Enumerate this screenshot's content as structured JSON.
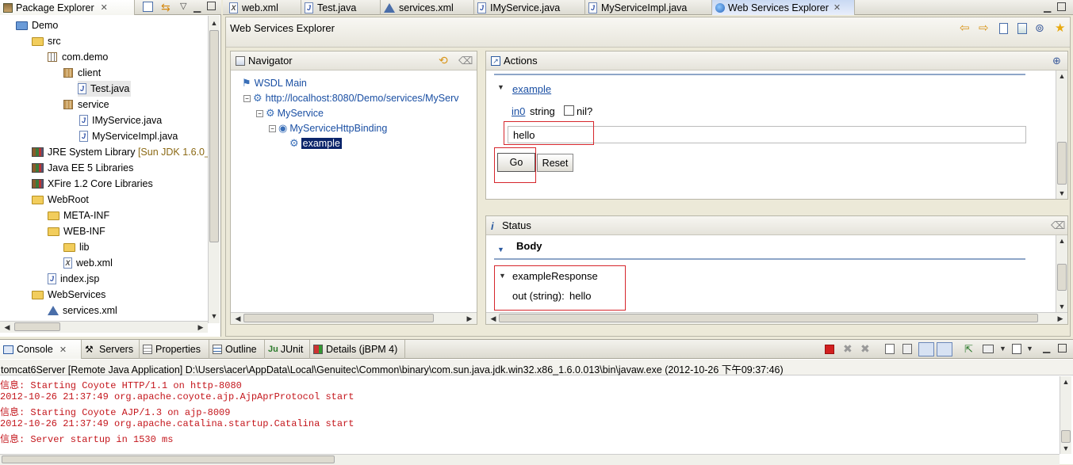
{
  "package_explorer": {
    "tab_label": "Package Explorer",
    "tree": [
      {
        "label": "Demo",
        "icon": "project-icon"
      },
      {
        "label": "src",
        "icon": "source-folder-icon"
      },
      {
        "label": "com.demo",
        "icon": "package-icon"
      },
      {
        "label": "client",
        "icon": "package-icon"
      },
      {
        "label": "Test.java",
        "icon": "java-file-icon"
      },
      {
        "label": "service",
        "icon": "package-icon"
      },
      {
        "label": "IMyService.java",
        "icon": "java-file-icon"
      },
      {
        "label": "MyServiceImpl.java",
        "icon": "java-file-icon"
      },
      {
        "label": "JRE System Library",
        "suffix": "[Sun JDK 1.6.0_",
        "icon": "library-icon"
      },
      {
        "label": "Java EE 5 Libraries",
        "icon": "library-icon"
      },
      {
        "label": "XFire 1.2 Core Libraries",
        "icon": "library-icon"
      },
      {
        "label": "WebRoot",
        "icon": "folder-icon"
      },
      {
        "label": "META-INF",
        "icon": "folder-icon"
      },
      {
        "label": "WEB-INF",
        "icon": "folder-icon"
      },
      {
        "label": "lib",
        "icon": "folder-icon"
      },
      {
        "label": "web.xml",
        "icon": "xml-file-icon"
      },
      {
        "label": "index.jsp",
        "icon": "jsp-file-icon"
      },
      {
        "label": "WebServices",
        "icon": "folder-icon"
      },
      {
        "label": "services.xml",
        "icon": "xml-file-icon"
      }
    ]
  },
  "editor_tabs": [
    {
      "label": "web.xml"
    },
    {
      "label": "Test.java"
    },
    {
      "label": "services.xml"
    },
    {
      "label": "IMyService.java"
    },
    {
      "label": "MyServiceImpl.java"
    },
    {
      "label": "Web Services Explorer"
    }
  ],
  "wse": {
    "title": "Web Services Explorer",
    "navigator": {
      "title": "Navigator",
      "items": [
        {
          "label": "WSDL Main"
        },
        {
          "label": "http://localhost:8080/Demo/services/MyServ"
        },
        {
          "label": "MyService"
        },
        {
          "label": "MyServiceHttpBinding"
        },
        {
          "label": "example"
        }
      ]
    },
    "actions": {
      "title": "Actions",
      "operation": "example",
      "param_name": "in0",
      "param_type": "string",
      "nil_label": "nil?",
      "input_value": "hello",
      "go_label": "Go",
      "reset_label": "Reset"
    },
    "status": {
      "title": "Status",
      "body_label": "Body",
      "response_label": "exampleResponse",
      "out_label": "out (string):",
      "out_value": "hello"
    }
  },
  "bottom_tabs": [
    {
      "label": "Console"
    },
    {
      "label": "Servers"
    },
    {
      "label": "Properties"
    },
    {
      "label": "Outline"
    },
    {
      "label": "JUnit"
    },
    {
      "label": "Details (jBPM 4)"
    }
  ],
  "console": {
    "header": "tomcat6Server [Remote Java Application] D:\\Users\\acer\\AppData\\Local\\Genuitec\\Common\\binary\\com.sun.java.jdk.win32.x86_1.6.0.013\\bin\\javaw.exe (2012-10-26 下午09:37:46)",
    "lines": [
      "信息: Starting Coyote HTTP/1.1 on http-8080",
      "2012-10-26 21:37:49 org.apache.coyote.ajp.AjpAprProtocol start",
      "信息: Starting Coyote AJP/1.3 on ajp-8009",
      "2012-10-26 21:37:49 org.apache.catalina.startup.Catalina start",
      "信息: Server startup in 1530 ms"
    ]
  }
}
